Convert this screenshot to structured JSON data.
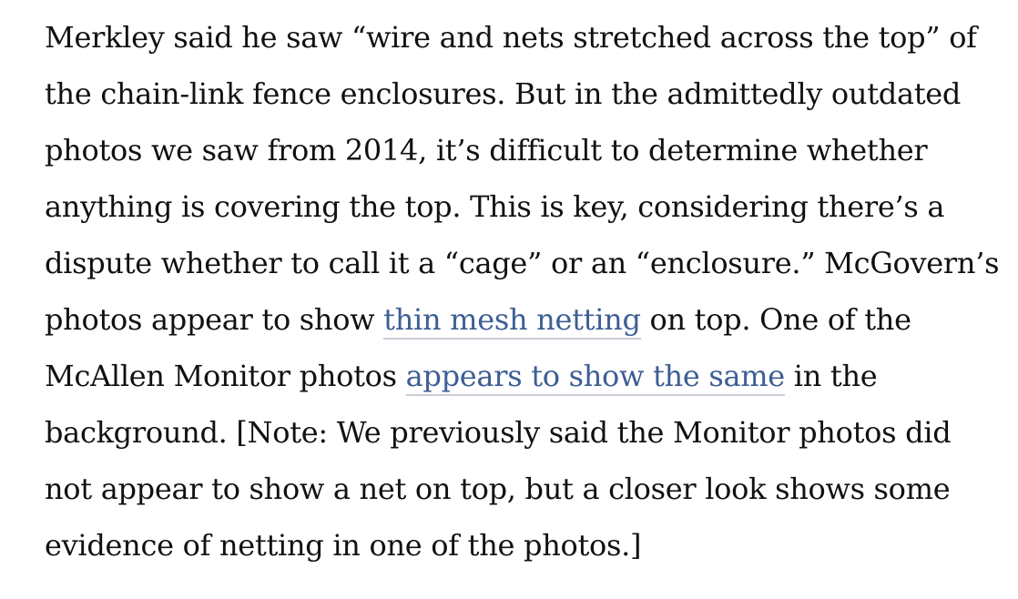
{
  "article": {
    "lines": [
      {
        "text": "Merkley said he saw “wire and nets stretched across the top” of"
      },
      {
        "text": "the chain-link fence enclosures. But in the admittedly outdated"
      },
      {
        "text": "photos we saw from 2014, it’s difficult to determine whether"
      },
      {
        "text": "anything is covering the top. This is key, considering there’s a"
      },
      {
        "text": "dispute whether to call it a “cage” or an “enclosure.” McGovern’s"
      },
      {
        "before": "photos appear to show ",
        "link": "thin mesh netting",
        "after": " on top. One of the"
      },
      {
        "before": "McAllen Monitor photos ",
        "link": "appears to show the same",
        "after": " in the"
      },
      {
        "text": "background. [Note: We previously said the Monitor photos did"
      },
      {
        "text": "not appear to show a net on top, but a closer look shows some"
      },
      {
        "text": "evidence of netting in one of the photos.]"
      }
    ]
  },
  "colors": {
    "text": "#111111",
    "link": "#3d5e95",
    "link_underline": "#c9ced6",
    "background": "#ffffff"
  }
}
